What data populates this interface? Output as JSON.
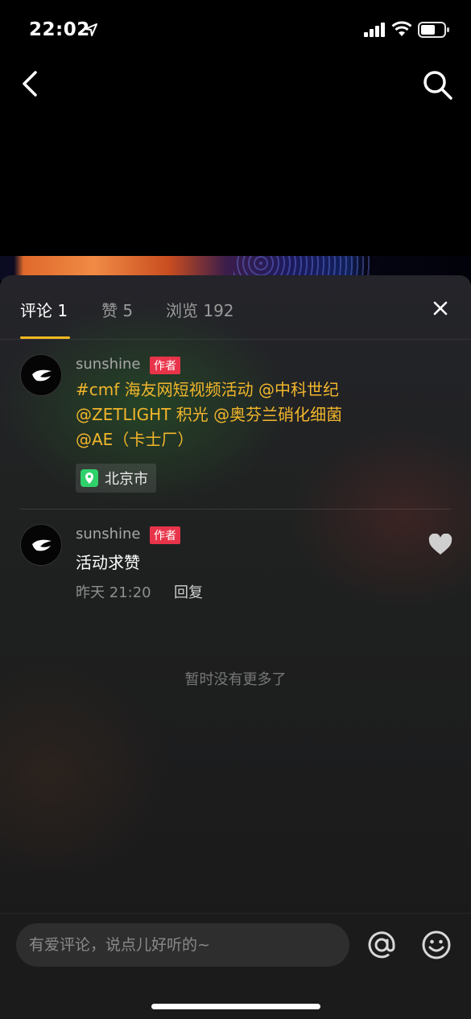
{
  "status_bar": {
    "time": "22:02"
  },
  "tabs": [
    {
      "label": "评论 1",
      "active": true
    },
    {
      "label": "赞 5",
      "active": false
    },
    {
      "label": "浏览 192",
      "active": false
    }
  ],
  "post": {
    "username": "sunshine",
    "badge": "作者",
    "lines": [
      "#cmf 海友网短视频活动 @中科世纪",
      "@ZETLIGHT 积光 @奥芬兰硝化细菌",
      "@AE（卡士厂）"
    ],
    "location": "北京市"
  },
  "comment": {
    "username": "sunshine",
    "badge": "作者",
    "text": "活动求赞",
    "time": "昨天 21:20",
    "reply": "回复"
  },
  "no_more_text": "暂时没有更多了",
  "input": {
    "placeholder": "有爱评论，说点儿好听的~"
  },
  "colors": {
    "accent": "#f5b921",
    "mention": "#f2b62c",
    "badge": "#e8344a",
    "location_pin": "#2fd16b"
  }
}
